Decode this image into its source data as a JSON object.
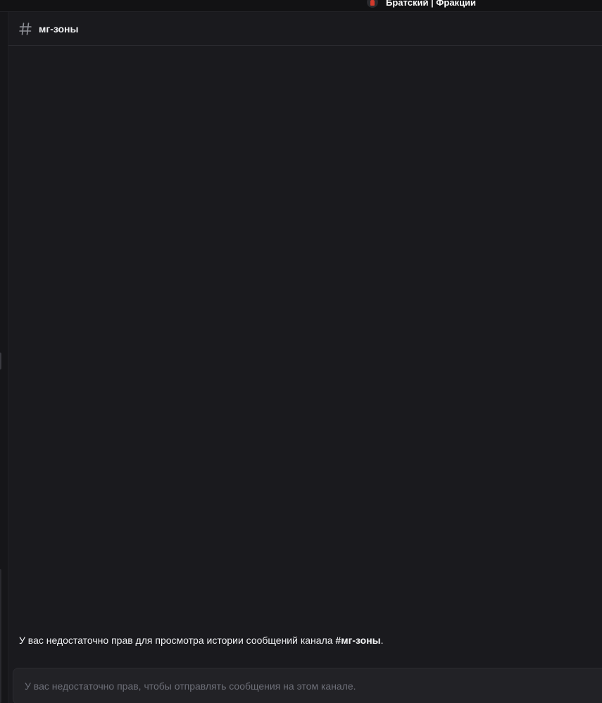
{
  "window": {
    "server_name": "Братский | Фракции"
  },
  "channel": {
    "icon": "hash-icon",
    "name": "мг-зоны"
  },
  "messages": {
    "notice_prefix": "У вас недостаточно прав для просмотра истории сообщений канала ",
    "notice_channel": "#мг-зоны",
    "notice_suffix": "."
  },
  "composer": {
    "placeholder": "У вас недостаточно прав, чтобы отправлять сообщения на этом канале."
  },
  "colors": {
    "background": "#1a1a1e",
    "titlebar": "#121214",
    "text_primary": "#f2f3f5",
    "text_muted": "#6d6f78",
    "composer_bg": "#222226"
  }
}
